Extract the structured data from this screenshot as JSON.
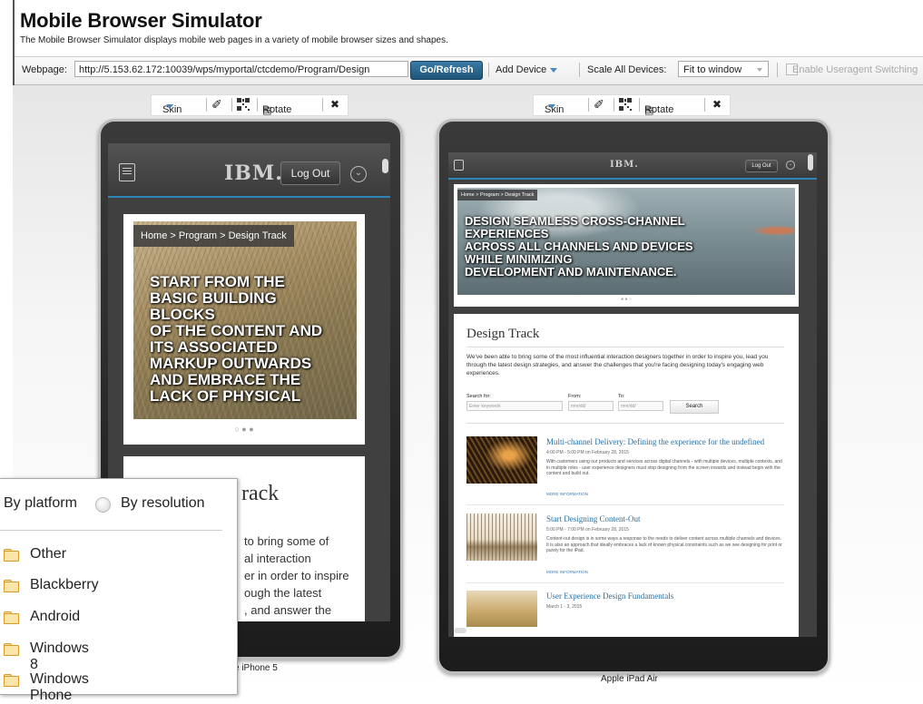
{
  "header": {
    "title": "Mobile Browser Simulator",
    "subtitle": "The Mobile Browser Simulator displays mobile web pages in a variety of mobile browser sizes and shapes."
  },
  "toolbar": {
    "webpage_label": "Webpage:",
    "url_value": "http://5.153.62.172:10039/wps/myportal/ctcdemo/Program/Design",
    "go_label": "Go/Refresh",
    "add_device_label": "Add Device",
    "scale_label": "Scale All Devices:",
    "scale_value": "Fit to window",
    "useragent_label": "Enable Useragent Switching"
  },
  "device_toolbar": {
    "skin_label": "Skin",
    "rotate_label": "Rotate"
  },
  "app": {
    "logo": "IBM.",
    "logout_label": "Log Out",
    "breadcrumb_phone": "Home > Program > Design Track",
    "breadcrumb_ipad": "Home > Program > Design Track",
    "hero_phone": [
      "START FROM THE",
      "BASIC BUILDING",
      "BLOCKS",
      "OF THE CONTENT AND",
      "ITS ASSOCIATED",
      "MARKUP OUTWARDS",
      "AND EMBRACE THE",
      "LACK OF PHYSICAL"
    ],
    "hero_ipad": [
      "DESIGN SEAMLESS CROSS-CHANNEL",
      "EXPERIENCES",
      "ACROSS ALL CHANNELS AND DEVICES",
      "WHILE MINIMIZING",
      "DEVELOPMENT AND MAINTENANCE."
    ],
    "section_title": "Design Track",
    "phone_section_fragment": "rack",
    "phone_para_lines": [
      "to bring some of",
      "al interaction",
      "er in order to inspire",
      "ough the latest",
      ", and answer the"
    ],
    "ipad_intro": "We've been able to bring some of the most influential interaction designers together in order to inspire you, lead you through the latest design strategies, and answer the challenges that you're facing designing today's engaging web experiences.",
    "search_for_label": "Search for:",
    "search_placeholder": "Enter keywords",
    "from_label": "From:",
    "to_label": "To:",
    "date_placeholder": "mm/dd/",
    "search_button": "Search",
    "events": [
      {
        "title": "Multi-channel Delivery: Defining the experience for the undefined",
        "time": "4:00 PM - 5:00 PM on February 28, 2015",
        "desc": "With customers using our products and services across digital channels - with multiple devices, multiple contexts, and in multiple roles - user experience designers must stop designing from the screen inwards and instead begin with the content and build out.",
        "more": "MORE INFORMATION"
      },
      {
        "title": "Start Designing Content-Out",
        "time": "5:00 PM - 7:00 PM on February 28, 2015",
        "desc": "Content-out design is in some ways a response to the needs to deliver content across multiple channels and devices. It is also an approach that ideally embraces a lack of known physical constraints such as we see designing for print or purely for the iPad.",
        "more": "MORE INFORMATION"
      },
      {
        "title": "User Experience Design Fundamentals",
        "time": "March 1 - 3, 2015",
        "desc": "",
        "more": ""
      }
    ]
  },
  "devices": {
    "phone_name_fragment": "e iPhone 5",
    "ipad_name": "Apple iPad Air"
  },
  "platform_panel": {
    "by_platform": "By platform",
    "by_resolution": "By resolution",
    "items": [
      "Other",
      "Blackberry",
      "Android",
      "Windows 8",
      "Windows Phone"
    ]
  },
  "colors": {
    "go_button": "#1d5478",
    "accent_blue": "#2e86b8",
    "folder": "#fbe5a9"
  }
}
